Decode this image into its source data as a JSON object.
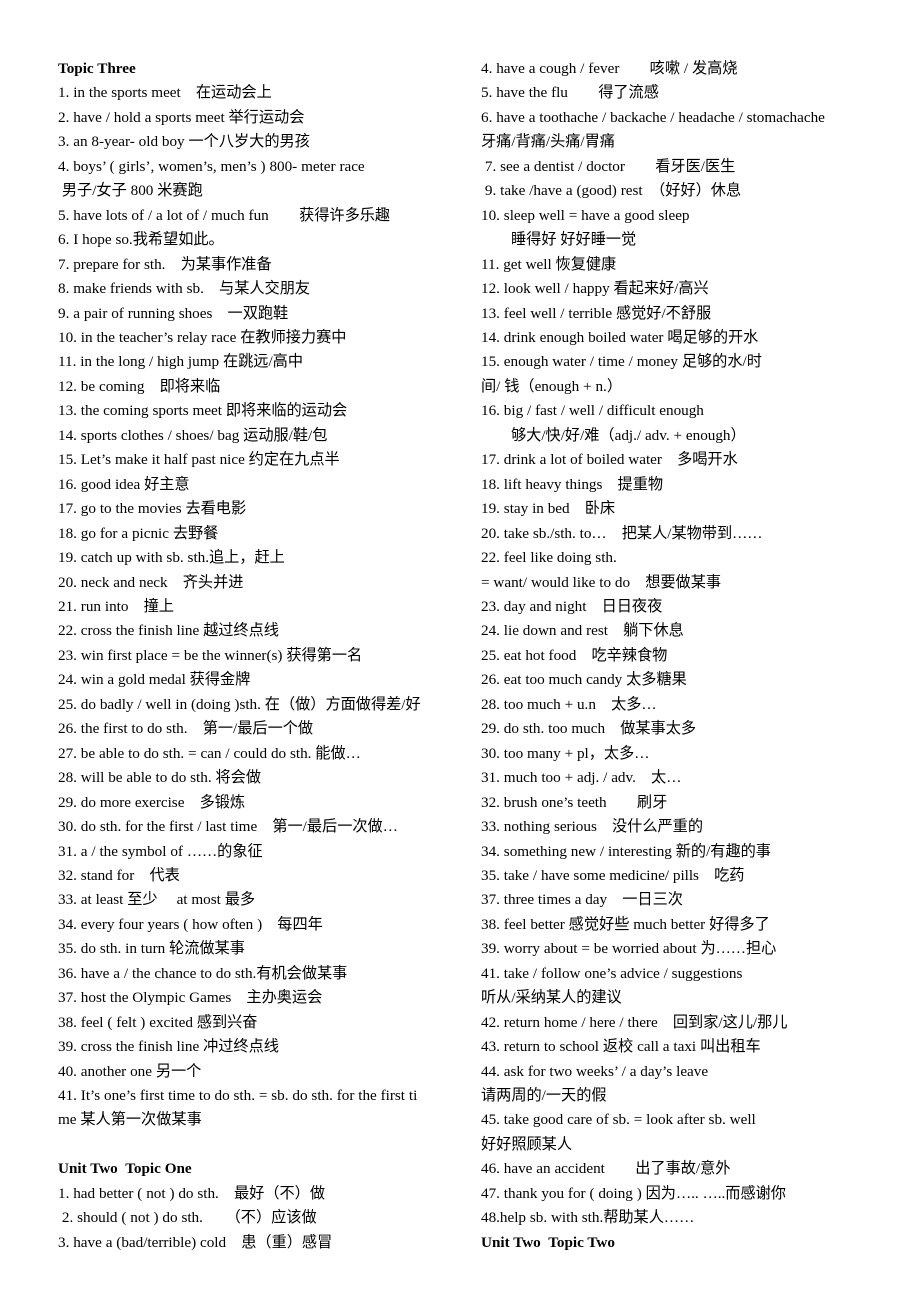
{
  "document": {
    "type": "study-notes",
    "language": "English-Chinese",
    "left_column": [
      {
        "text": "Topic Three",
        "style": "bold"
      },
      {
        "text": "1. in the sports meet　在运动会上"
      },
      {
        "text": "2. have / hold a sports meet 举行运动会"
      },
      {
        "text": "3. an 8-year- old boy 一个八岁大的男孩"
      },
      {
        "text": "4. boys’ ( girls’, women’s, men’s ) 800- meter race"
      },
      {
        "text": " 男子/女子 800 米赛跑"
      },
      {
        "text": "5. have lots of / a lot of / much fun　　获得许多乐趣"
      },
      {
        "text": "6. I hope so.我希望如此。"
      },
      {
        "text": "7. prepare for sth.　为某事作准备"
      },
      {
        "text": "8. make friends with sb.　与某人交朋友"
      },
      {
        "text": "9. a pair of running shoes　一双跑鞋"
      },
      {
        "text": "10. in the teacher’s relay race 在教师接力赛中"
      },
      {
        "text": "11. in the long / high jump 在跳远/高中"
      },
      {
        "text": "12. be coming　即将来临"
      },
      {
        "text": "13. the coming sports meet 即将来临的运动会"
      },
      {
        "text": "14. sports clothes / shoes/ bag 运动服/鞋/包"
      },
      {
        "text": "15. Let’s make it half past nice 约定在九点半"
      },
      {
        "text": "16. good idea 好主意"
      },
      {
        "text": "17. go to the movies 去看电影"
      },
      {
        "text": "18. go for a picnic 去野餐"
      },
      {
        "text": "19. catch up with sb. sth.追上，赶上"
      },
      {
        "text": "20. neck and neck　齐头并进"
      },
      {
        "text": "21. run into　撞上"
      },
      {
        "text": "22. cross the finish line 越过终点线"
      },
      {
        "text": "23. win first place = be the winner(s) 获得第一名"
      },
      {
        "text": "24. win a gold medal 获得金牌"
      },
      {
        "text": "25. do badly / well in (doing )sth. 在（做）方面做得差/好"
      },
      {
        "text": "26. the first to do sth.　第一/最后一个做"
      },
      {
        "text": "27. be able to do sth. = can / could do sth. 能做…"
      },
      {
        "text": "28. will be able to do sth. 将会做"
      },
      {
        "text": "29. do more exercise　多锻炼"
      },
      {
        "text": "30. do sth. for the first / last time　第一/最后一次做…"
      },
      {
        "text": "31. a / the symbol of ……的象征"
      },
      {
        "text": "32. stand for　代表"
      },
      {
        "text": "33. at least 至少　 at most 最多"
      },
      {
        "text": "34. every four years ( how often )　每四年"
      },
      {
        "text": "35. do sth. in turn 轮流做某事"
      },
      {
        "text": "36. have a / the chance to do sth.有机会做某事"
      },
      {
        "text": "37. host the Olympic Games　主办奥运会"
      },
      {
        "text": "38. feel ( felt ) excited 感到兴奋"
      },
      {
        "text": "39. cross the finish line 冲过终点线"
      },
      {
        "text": "40. another one 另一个"
      },
      {
        "text": "41. It’s one’s first time to do sth. = sb. do sth. for the first ti"
      },
      {
        "text": "me 某人第一次做某事"
      },
      {
        "text": "",
        "style": "blank"
      },
      {
        "text": "Unit Two  Topic One",
        "style": "bold"
      },
      {
        "text": "1. had better ( not ) do sth.　最好（不）做"
      },
      {
        "text": " 2. should ( not ) do sth.　　（不）应该做"
      },
      {
        "text": "3. have a (bad/terrible) cold　患（重）感冒"
      }
    ],
    "right_column": [
      {
        "text": "4. have a cough / fever　　咳嗽 / 发高烧"
      },
      {
        "text": "5. have the flu　　得了流感"
      },
      {
        "text": "6. have a toothache / backache / headache / stomachache"
      },
      {
        "text": "牙痛/背痛/头痛/胃痛"
      },
      {
        "text": " 7. see a dentist / doctor　　看牙医/医生"
      },
      {
        "text": " 9. take /have a (good) rest　（好好）休息"
      },
      {
        "text": "10. sleep well = have a good sleep"
      },
      {
        "text": "睡得好 好好睡一觉",
        "style": "indent-md"
      },
      {
        "text": "11. get well 恢复健康"
      },
      {
        "text": "12. look well / happy 看起来好/高兴"
      },
      {
        "text": "13. feel well / terrible 感觉好/不舒服"
      },
      {
        "text": "14. drink enough boiled water 喝足够的开水"
      },
      {
        "text": "15. enough water / time / money 足够的水/时"
      },
      {
        "text": "间/ 钱（enough + n.）"
      },
      {
        "text": "16. big / fast / well / difficult enough"
      },
      {
        "text": "够大/快/好/难（adj./ adv. + enough）",
        "style": "indent-md"
      },
      {
        "text": "17. drink a lot of boiled water　多喝开水"
      },
      {
        "text": "18. lift heavy things　提重物"
      },
      {
        "text": "19. stay in bed　卧床"
      },
      {
        "text": "20. take sb./sth. to…　把某人/某物带到……"
      },
      {
        "text": "22. feel like doing sth."
      },
      {
        "text": "= want/ would like to do　想要做某事"
      },
      {
        "text": "23. day and night　日日夜夜"
      },
      {
        "text": "24. lie down and rest　躺下休息"
      },
      {
        "text": "25. eat hot food　吃辛辣食物"
      },
      {
        "text": "26. eat too much candy 太多糖果"
      },
      {
        "text": "28. too much + u.n　太多…"
      },
      {
        "text": "29. do sth. too much　做某事太多"
      },
      {
        "text": "30. too many + pl，太多…"
      },
      {
        "text": "31. much too + adj. / adv.　太…"
      },
      {
        "text": "32. brush one’s teeth　　刷牙"
      },
      {
        "text": "33. nothing serious　没什么严重的"
      },
      {
        "text": "34. something new / interesting 新的/有趣的事"
      },
      {
        "text": "35. take / have some medicine/ pills　吃药"
      },
      {
        "text": "37. three times a day　一日三次"
      },
      {
        "text": "38. feel better 感觉好些 much better 好得多了"
      },
      {
        "text": "39. worry about = be worried about 为……担心"
      },
      {
        "text": "41. take / follow one’s advice / suggestions"
      },
      {
        "text": "听从/采纳某人的建议"
      },
      {
        "text": "42. return home / here / there　回到家/这儿/那儿"
      },
      {
        "text": "43. return to school 返校 call a taxi 叫出租车"
      },
      {
        "text": "44. ask for two weeks’ / a day’s leave"
      },
      {
        "text": "请两周的/一天的假"
      },
      {
        "text": "45. take good care of sb. = look after sb. well"
      },
      {
        "text": "好好照顾某人"
      },
      {
        "text": "46. have an accident　　出了事故/意外"
      },
      {
        "text": "47. thank you for ( doing ) 因为….. …..而感谢你"
      },
      {
        "text": "48.help sb. with sth.帮助某人……"
      },
      {
        "text": "Unit Two  Topic Two",
        "style": "bold"
      }
    ]
  }
}
